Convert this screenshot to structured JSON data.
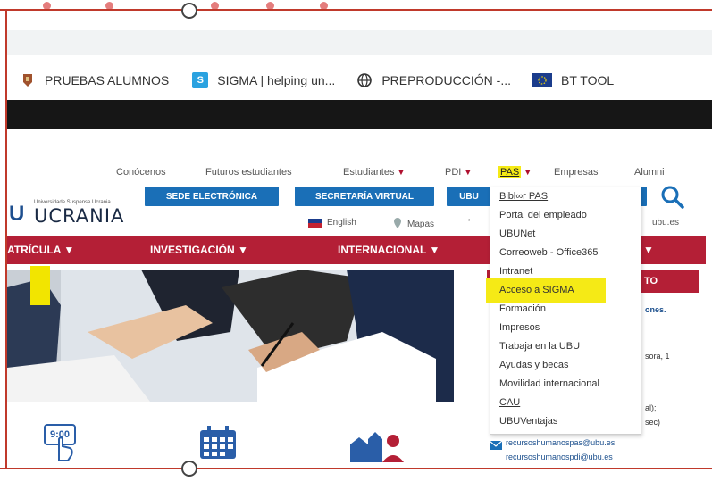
{
  "browser": {
    "bookmarks": [
      {
        "icon": "shield-icon",
        "label": "PRUEBAS ALUMNOS",
        "color": "#a0522d"
      },
      {
        "icon": "s-badge-icon",
        "label": "SIGMA | helping un...",
        "color": "#2aa2e0"
      },
      {
        "icon": "globe-icon",
        "label": "PREPRODUCCIÓN -...",
        "color": "#333333"
      },
      {
        "icon": "eu-flag-icon",
        "label": "BT TOOL",
        "color": "#1b3c8c"
      }
    ]
  },
  "site": {
    "topnav": {
      "conocenos": "Conócenos",
      "futuros": "Futuros estudiantes",
      "estudiantes": "Estudiantes",
      "pdi": "PDI",
      "pas": "PAS",
      "empresas": "Empresas",
      "alumni": "Alumni"
    },
    "logo": {
      "letter": "U",
      "small": "Universidade Suspense Ucrania",
      "name": "UCRANIA"
    },
    "buttons": {
      "sede": "SEDE ELECTRÓNICA",
      "secretaria": "SECRETARÍA VIRTUAL",
      "ubu": "UBU"
    },
    "utility": {
      "english": "English",
      "mapas": "Mapas",
      "phone_prefix": "‘",
      "email_fragment": "ubu.es"
    },
    "mainnav": {
      "matricula": "ATRÍCULA",
      "investigacion": "INVESTIGACIÓN",
      "internacional": "INTERNACIONAL"
    },
    "rpanel": {
      "head": "TO",
      "frag1": "ones.",
      "frag2": "sora, 1",
      "frag3": "al);",
      "frag4": "sec)",
      "email1": "recursoshumanospas@ubu.es",
      "email2": "recursoshumanospdi@ubu.es"
    },
    "bottom_icons": {
      "time_label": "9:00"
    }
  },
  "dropdown": {
    "items": [
      "Bibl∞r PAS",
      "Portal del empleado",
      "UBUNet",
      "Correoweb - Office365",
      "Intranet",
      "Acceso a SIGMA",
      "Formación",
      "Impresos",
      "Trabaja en la UBU",
      "Ayudas y becas",
      "Movilidad internacional",
      "CAU",
      "UBUVentajas"
    ]
  },
  "colors": {
    "brand_red": "#b41f36",
    "brand_blue": "#1a6fb7",
    "highlight": "#f5ea16",
    "selection": "#c0392b"
  }
}
